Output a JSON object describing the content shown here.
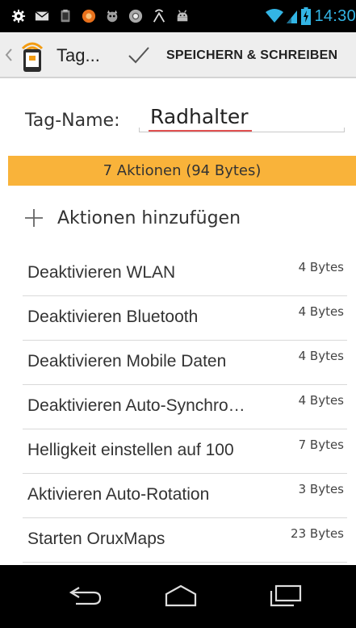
{
  "status_bar": {
    "icons": [
      "settings-icon",
      "mail-icon",
      "clipboard-icon",
      "orange-app-icon",
      "ogre-icon",
      "chrome-icon",
      "antenna-icon",
      "android-icon"
    ],
    "time": "14:30",
    "time_color": "#33b5e5"
  },
  "action_bar": {
    "title": "Tag...",
    "save_label": "SPEICHERN & SCHREIBEN"
  },
  "form": {
    "tag_name_label": "Tag-Name:",
    "tag_name_value": "Radhalter"
  },
  "summary": {
    "text": "7 Aktionen (94 Bytes)",
    "color": "#f9b33a"
  },
  "add_action": {
    "label": "Aktionen hinzufügen"
  },
  "actions": [
    {
      "name": "Deaktivieren WLAN",
      "size": "4 Bytes"
    },
    {
      "name": "Deaktivieren Bluetooth",
      "size": "4 Bytes"
    },
    {
      "name": "Deaktivieren Mobile Daten",
      "size": "4 Bytes"
    },
    {
      "name": "Deaktivieren Auto-Synchro…",
      "size": "4 Bytes"
    },
    {
      "name": "Helligkeit einstellen auf 100",
      "size": "7 Bytes"
    },
    {
      "name": "Aktivieren Auto-Rotation",
      "size": "3 Bytes"
    },
    {
      "name": "Starten OruxMaps",
      "size": "23 Bytes"
    }
  ],
  "nav_bar": {
    "icons": [
      "back-icon",
      "home-icon",
      "recents-icon"
    ]
  }
}
